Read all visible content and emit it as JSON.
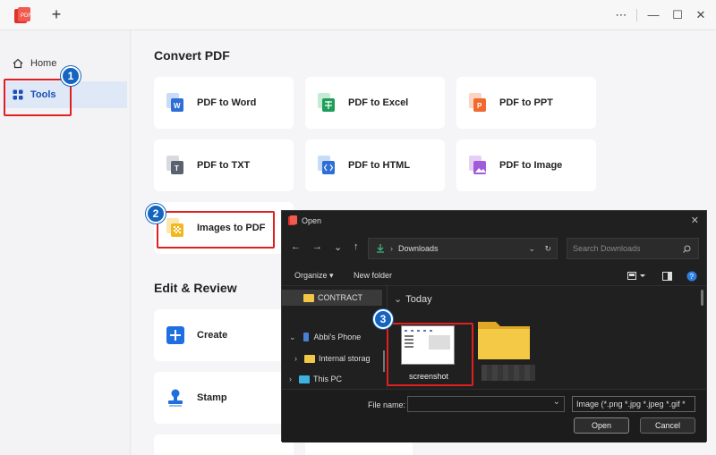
{
  "titlebar": {
    "new_tab": "+",
    "more": "⋯",
    "minimize": "—",
    "maximize": "☐",
    "close": "✕"
  },
  "sidebar": {
    "items": [
      {
        "label": "Home",
        "icon": "home-icon"
      },
      {
        "label": "Tools",
        "icon": "grid-icon",
        "active": true
      }
    ]
  },
  "convert": {
    "title": "Convert PDF",
    "tools": [
      {
        "label": "PDF to Word",
        "icon": "word-icon",
        "color": "#2d6fd6"
      },
      {
        "label": "PDF to Excel",
        "icon": "excel-icon",
        "color": "#1f9e5a"
      },
      {
        "label": "PDF to PPT",
        "icon": "ppt-icon",
        "color": "#f06a2f"
      },
      {
        "label": "PDF to TXT",
        "icon": "txt-icon",
        "color": "#5a6270"
      },
      {
        "label": "PDF to HTML",
        "icon": "html-icon",
        "color": "#2d6fd6"
      },
      {
        "label": "PDF to Image",
        "icon": "image-icon",
        "color": "#a15ad8"
      },
      {
        "label": "Images to PDF",
        "icon": "images-to-pdf-icon",
        "color": "#f2b81f"
      }
    ]
  },
  "edit": {
    "title": "Edit & Review",
    "tools": [
      {
        "label": "Create",
        "icon": "plus-icon",
        "color": "#1f6fe0"
      },
      {
        "label": "Stamp",
        "icon": "stamp-icon",
        "color": "#1f6fe0"
      }
    ]
  },
  "badges": [
    "1",
    "2",
    "3"
  ],
  "dialog": {
    "title": "Open",
    "address": "Downloads",
    "search_placeholder": "Search Downloads",
    "organize": "Organize ▾",
    "new_folder": "New folder",
    "nav_items": [
      {
        "label": "CONTRACT",
        "type": "folder"
      },
      {
        "label": "Abbi's Phone",
        "type": "phone"
      },
      {
        "label": "Internal storag",
        "type": "folder"
      },
      {
        "label": "This PC",
        "type": "pc"
      }
    ],
    "group": "Today",
    "file_label": "screenshot",
    "file_name_label": "File name:",
    "file_name_value": "",
    "filter": "Image (*.png *.jpg *.jpeg *.gif *",
    "open_button": "Open",
    "cancel_button": "Cancel"
  }
}
